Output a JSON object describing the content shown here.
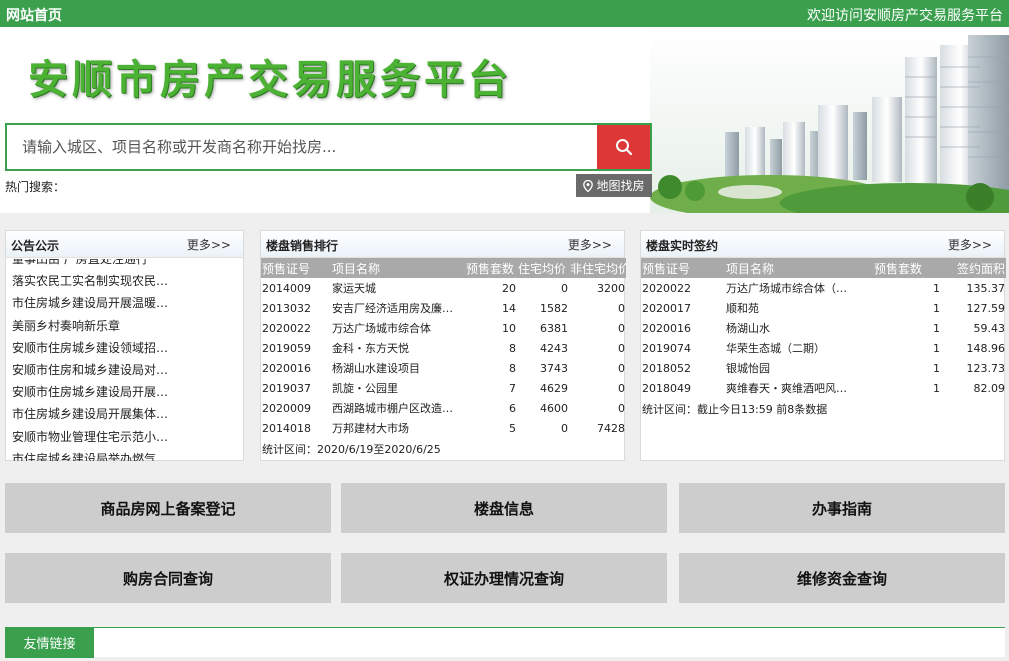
{
  "topbar": {
    "home": "网站首页",
    "welcome": "欢迎访问安顺房产交易服务平台"
  },
  "brand": {
    "title": "安顺市房产交易服务平台"
  },
  "search": {
    "placeholder": "请输入城区、项目名称或开发商名称开始找房...",
    "hot_label": "热门搜索：",
    "map_label": "地图找房"
  },
  "notices": {
    "title": "公告公示",
    "more": "更多>>",
    "items": [
      "董事田由 广房直处注通行",
      "落实农民工实名制实现农民…",
      "市住房城乡建设局开展温暖…",
      "美丽乡村奏响新乐章",
      "安顺市住房城乡建设领域招…",
      "安顺市住房和城乡建设局对…",
      "安顺市住房城乡建设局开展…",
      "市住房城乡建设局开展集体…",
      "安顺市物业管理住宅示范小…",
      "市住房城乡建设局举办燃气…"
    ]
  },
  "sales": {
    "title": "楼盘销售排行",
    "more": "更多>>",
    "headers": [
      "预售证号",
      "项目名称",
      "预售套数",
      "住宅均价",
      "非住宅均价"
    ],
    "rows": [
      [
        "2014009",
        "家运天城",
        "20",
        "0",
        "3200"
      ],
      [
        "2013032",
        "安吉厂经济适用房及廉…",
        "14",
        "1582",
        "0"
      ],
      [
        "2020022",
        "万达广场城市综合体",
        "10",
        "6381",
        "0"
      ],
      [
        "2019059",
        "金科・东方天悦",
        "8",
        "4243",
        "0"
      ],
      [
        "2020016",
        "杨湖山水建设项目",
        "8",
        "3743",
        "0"
      ],
      [
        "2019037",
        "凯旋・公园里",
        "7",
        "4629",
        "0"
      ],
      [
        "2020009",
        "西湖路城市棚户区改造…",
        "6",
        "4600",
        "0"
      ],
      [
        "2014018",
        "万邦建材大市场",
        "5",
        "0",
        "7428"
      ]
    ],
    "footer": "统计区间：2020/6/19至2020/6/25"
  },
  "signing": {
    "title": "楼盘实时签约",
    "more": "更多>>",
    "headers": [
      "预售证号",
      "项目名称",
      "预售套数",
      "签约面积"
    ],
    "rows": [
      [
        "2020022",
        "万达广场城市综合体（…",
        "1",
        "135.37"
      ],
      [
        "2020017",
        "顺和苑",
        "1",
        "127.59"
      ],
      [
        "2020016",
        "杨湖山水",
        "1",
        "59.43"
      ],
      [
        "2019074",
        "华荣生态城（二期）",
        "1",
        "148.96"
      ],
      [
        "2018052",
        "银城怡园",
        "1",
        "123.73"
      ],
      [
        "2018049",
        "爽维春天・爽维酒吧风…",
        "1",
        "82.09"
      ]
    ],
    "footer": "统计区间：截止今日13:59 前8条数据"
  },
  "tiles": {
    "t1": "商品房网上备案登记",
    "t2": "楼盘信息",
    "t3": "办事指南",
    "t4": "购房合同查询",
    "t5": "权证办理情况查询",
    "t6": "维修资金查询"
  },
  "friend": {
    "label": "友情链接"
  },
  "colors": {
    "brand_green": "#3aa04e",
    "search_red": "#dd3737",
    "tile_gray": "#cdcdcd"
  }
}
